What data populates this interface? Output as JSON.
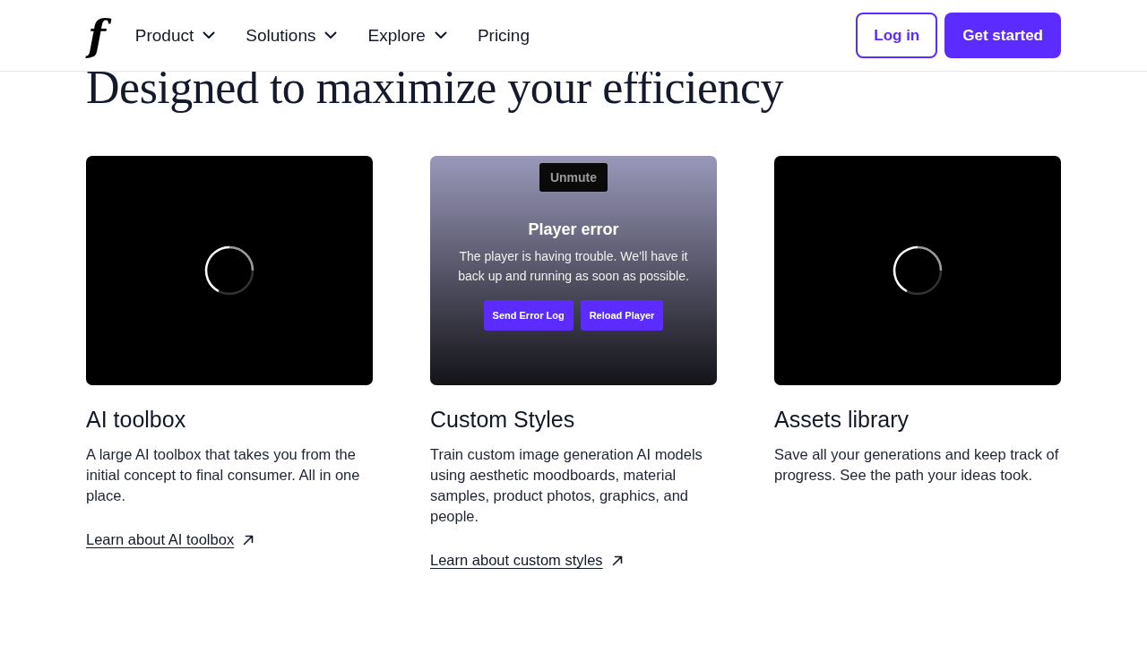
{
  "header": {
    "logo": "f",
    "nav": [
      {
        "label": "Product",
        "dropdown": true
      },
      {
        "label": "Solutions",
        "dropdown": true
      },
      {
        "label": "Explore",
        "dropdown": true
      },
      {
        "label": "Pricing",
        "dropdown": false
      }
    ],
    "login": "Log in",
    "cta": "Get started"
  },
  "heading": "Designed to maximize your efficiency",
  "cards": [
    {
      "media": {
        "kind": "loading"
      },
      "title": "AI toolbox",
      "description": "A large AI toolbox that takes you from the initial concept to final consumer. All in one place.",
      "link": "Learn about AI toolbox"
    },
    {
      "media": {
        "kind": "error",
        "unmute": "Unmute",
        "error_title": "Player error",
        "error_text": "The player is having trouble. We’ll have it back up and running as soon as possible.",
        "buttons": [
          "Send Error Log",
          "Reload Player"
        ]
      },
      "title": "Custom Styles",
      "description": "Train custom image generation AI models using aesthetic moodboards, material samples, product photos, graphics, and people.",
      "link": "Learn about custom styles"
    },
    {
      "media": {
        "kind": "loading"
      },
      "title": "Assets library",
      "description": "Save all your generations and keep track of progress. See the path your ideas took."
    }
  ]
}
